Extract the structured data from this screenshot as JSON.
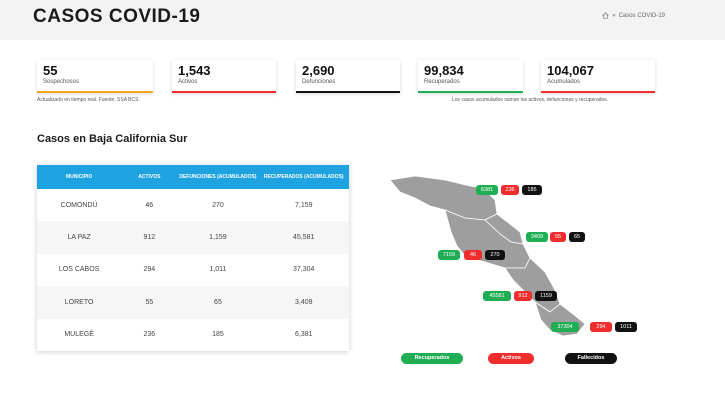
{
  "header": {
    "title": "CASOS COVID-19",
    "breadcrumb_current": "Casos COVID-19",
    "breadcrumb_sep": "»"
  },
  "stats": [
    {
      "value": "55",
      "label": "Sospechosos",
      "color": "#f5a623"
    },
    {
      "value": "1,543",
      "label": "Activos",
      "color": "#ef2d2d"
    },
    {
      "value": "2,690",
      "label": "Defunciones",
      "color": "#111111"
    },
    {
      "value": "99,834",
      "label": "Recuperados",
      "color": "#1fae54"
    },
    {
      "value": "104,067",
      "label": "Acumulados",
      "color": "#ef2d2d"
    }
  ],
  "notes": {
    "left": "Actualizado en tiempo real. Fuente: SSA BCS.",
    "right": "Los casos acumulados suman los activos, defunciones y recuperados."
  },
  "section_title": "Casos en Baja California Sur",
  "table": {
    "headers": [
      "MUNICIPIO",
      "ACTIVOS",
      "DEFUNCIONES (ACUMULADOS)",
      "RECUPERADOS (ACUMULADOS)"
    ],
    "rows": [
      [
        "COMONDÚ",
        "46",
        "270",
        "7,159"
      ],
      [
        "LA PAZ",
        "912",
        "1,159",
        "45,581"
      ],
      [
        "LOS CABOS",
        "294",
        "1,011",
        "37,304"
      ],
      [
        "LORETO",
        "55",
        "65",
        "3,409"
      ],
      [
        "MULEGÉ",
        "236",
        "185",
        "6,381"
      ]
    ]
  },
  "map_tags": {
    "mulege": [
      "6381",
      "236",
      "185"
    ],
    "loreto": [
      "3409",
      "55",
      "65"
    ],
    "comondu": [
      "7159",
      "46",
      "270"
    ],
    "lapaz": [
      "45581",
      "912",
      "1159"
    ],
    "loscabos": [
      "37304",
      "294",
      "1011"
    ]
  },
  "legend": {
    "recuperados": "Recuperados",
    "activos": "Activos",
    "fallecidos": "Fallecidos"
  },
  "colors": {
    "header_bg": "#f3f3f3",
    "table_head": "#1fa3e0",
    "map_fill": "#9e9e9e",
    "green": "#1fae54",
    "red": "#ef2d2d",
    "black": "#111111"
  }
}
